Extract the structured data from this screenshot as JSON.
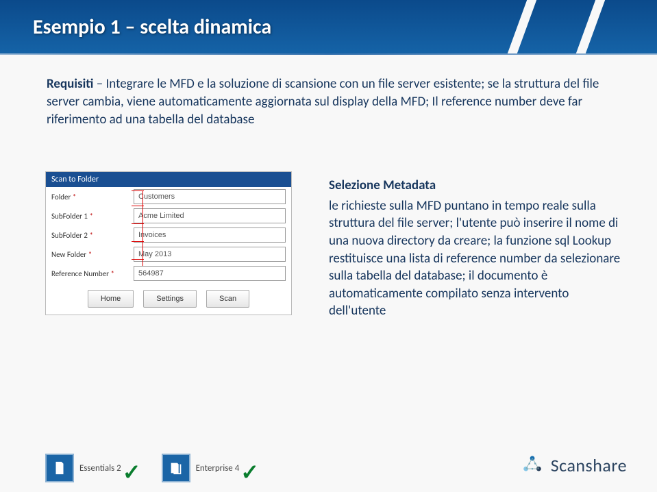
{
  "slide": {
    "title": "Esempio 1 – scelta dinamica",
    "requisiti_label": "Requisiti",
    "requisiti_text": " – Integrare le MFD e la soluzione di scansione con un file server esistente; se la struttura del file server cambia, viene automaticamente aggiornata sul display della MFD; Il reference number deve far riferimento ad una tabella del database"
  },
  "mfd": {
    "header": "Scan to Folder",
    "rows": [
      {
        "label": "Folder",
        "required": true,
        "value": "Customers"
      },
      {
        "label": "SubFolder 1",
        "required": true,
        "value": "Acme Limited"
      },
      {
        "label": "SubFolder 2",
        "required": true,
        "value": "Invoices"
      },
      {
        "label": "New Folder",
        "required": true,
        "value": "May 2013"
      },
      {
        "label": "Reference Number",
        "required": true,
        "value": "564987"
      }
    ],
    "buttons": {
      "home": "Home",
      "settings": "Settings",
      "scan": "Scan"
    }
  },
  "explain": {
    "heading": "Selezione Metadata",
    "body1": "le richieste sulla MFD puntano in tempo reale sulla struttura del file server; l'utente può inserire il nome di una nuova directory da creare; la funzione sql Lookup restituisce una lista di reference number da selezionare sulla tabella del database; il documento è automaticamente compilato senza intervento dell'utente"
  },
  "badges": [
    {
      "label": "Essentials 2"
    },
    {
      "label": "Enterprise 4"
    }
  ],
  "logo": {
    "text": "Scanshare"
  }
}
